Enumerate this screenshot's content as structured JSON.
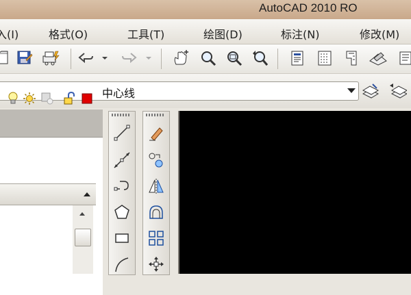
{
  "window": {
    "title": "AutoCAD 2010    RO"
  },
  "menubar": {
    "items": [
      {
        "label": "入(I)"
      },
      {
        "label": "格式(O)"
      },
      {
        "label": "工具(T)"
      },
      {
        "label": "绘图(D)"
      },
      {
        "label": "标注(N)"
      },
      {
        "label": "修改(M)"
      }
    ]
  },
  "layer_toolbar": {
    "current_layer": "中心线",
    "layer_color": "#e00000"
  },
  "colors": {
    "canvas": "#000000",
    "accent_red": "#e00000"
  },
  "icons": {
    "standard": [
      "open-icon",
      "save-icon",
      "plot-icon",
      "undo-icon",
      "redo-icon",
      "pan-icon",
      "zoom-realtime-icon",
      "zoom-window-icon",
      "zoom-previous-icon",
      "properties-icon",
      "design-center-icon",
      "tool-palettes-icon",
      "markup-icon"
    ],
    "draw": [
      "line-icon",
      "construction-line-icon",
      "polyline-icon",
      "polygon-icon",
      "rectangle-icon",
      "arc-icon"
    ],
    "modify": [
      "erase-icon",
      "copy-icon",
      "mirror-icon",
      "offset-icon",
      "array-icon",
      "move-icon"
    ]
  }
}
